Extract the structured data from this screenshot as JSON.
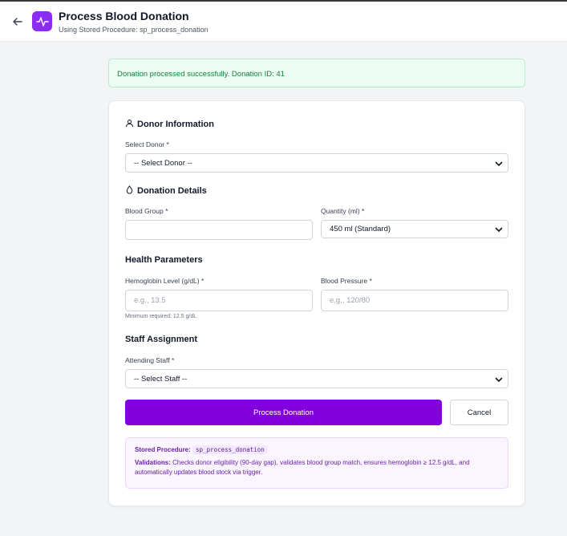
{
  "header": {
    "title": "Process Blood Donation",
    "subtitle": "Using Stored Procedure: sp_process_donation",
    "back_icon": "arrow-left-icon",
    "app_icon": "activity-pulse-icon"
  },
  "alert": {
    "message": "Donation processed successfully. Donation ID: 41"
  },
  "donor_section": {
    "title": "Donor Information",
    "select_label": "Select Donor *",
    "select_value": "-- Select Donor --"
  },
  "donation_section": {
    "title": "Donation Details",
    "blood_group_label": "Blood Group *",
    "blood_group_value": "",
    "quantity_label": "Quantity (ml) *",
    "quantity_value": "450 ml (Standard)"
  },
  "health_section": {
    "title": "Health Parameters",
    "hemoglobin_label": "Hemoglobin Level (g/dL) *",
    "hemoglobin_placeholder": "e.g., 13.5",
    "hemoglobin_hint": "Minimum required: 12.5 g/dL",
    "bp_label": "Blood Pressure *",
    "bp_placeholder": "e.g., 120/80"
  },
  "staff_section": {
    "title": "Staff Assignment",
    "select_label": "Attending Staff *",
    "select_value": "-- Select Staff --"
  },
  "actions": {
    "submit_label": "Process Donation",
    "cancel_label": "Cancel"
  },
  "info_box": {
    "procedure_label": "Stored Procedure:",
    "procedure_name": "sp_process_donation",
    "validations_label": "Validations:",
    "validations_text": "Checks donor eligibility (90-day gap), validates blood group match, ensures hemoglobin ≥ 12.5 g/dL, and automatically updates blood stock via trigger."
  },
  "colors": {
    "accent": "#8200db",
    "success_bg": "#ecfdf3",
    "success_text": "#15803d",
    "info_bg": "#faf5ff"
  }
}
